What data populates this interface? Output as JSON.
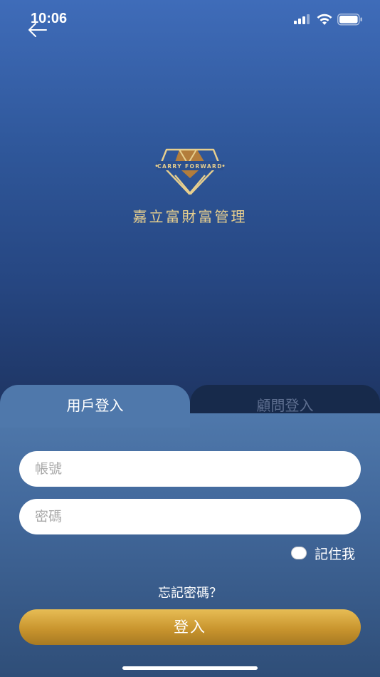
{
  "status_bar": {
    "time": "10:06"
  },
  "brand": {
    "logo_text": "CARRY FORWARD",
    "title": "嘉立富財富管理"
  },
  "tabs": [
    {
      "label": "用戶登入",
      "active": true
    },
    {
      "label": "顧問登入",
      "active": false
    }
  ],
  "form": {
    "account_placeholder": "帳號",
    "password_placeholder": "密碼",
    "remember_label": "記住我",
    "forgot_label": "忘記密碼？",
    "login_label": "登入"
  },
  "colors": {
    "gold": "#e7cf8e",
    "button": "#c9952e",
    "active_tab": "#4f78ab",
    "inactive_tab": "#172a4b"
  },
  "icons": [
    "back-arrow-icon",
    "signal-icon",
    "wifi-icon",
    "battery-icon",
    "diamond-logo"
  ]
}
